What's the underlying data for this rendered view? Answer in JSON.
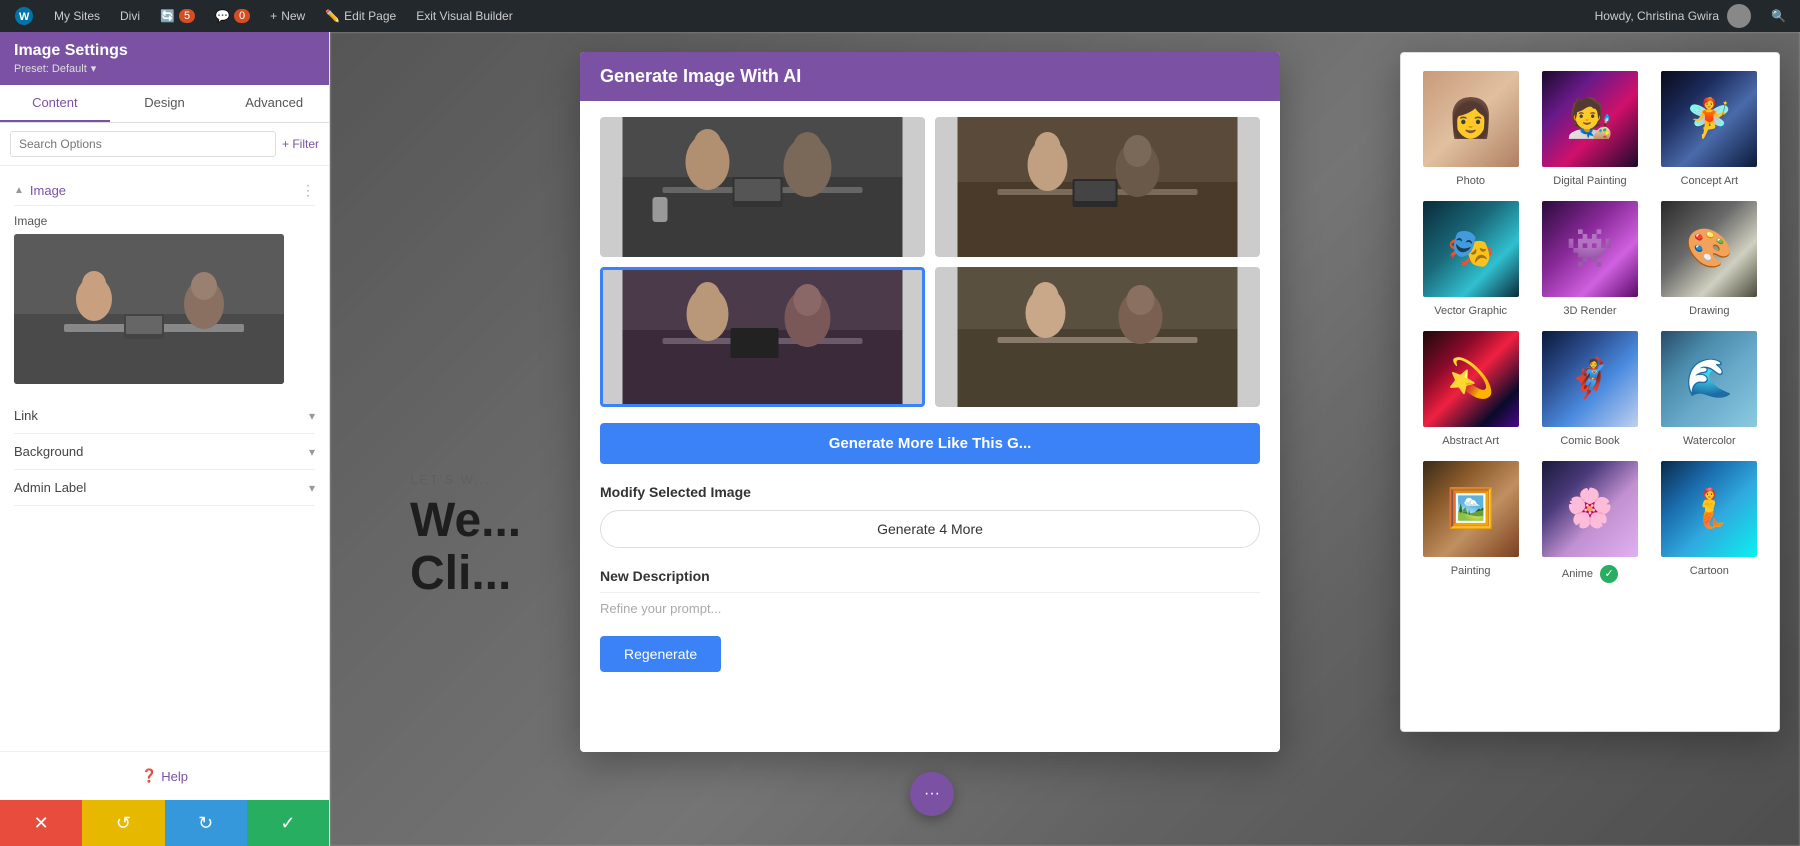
{
  "adminBar": {
    "wpLabel": "WordPress",
    "mySites": "My Sites",
    "divi": "Divi",
    "updates": "5",
    "comments": "0",
    "new": "New",
    "editPage": "Edit Page",
    "exitBuilder": "Exit Visual Builder",
    "user": "Howdy, Christina Gwira"
  },
  "leftPanel": {
    "title": "Image Settings",
    "preset": "Preset: Default",
    "tabs": [
      "Content",
      "Design",
      "Advanced"
    ],
    "activeTab": 0,
    "searchPlaceholder": "Search Options",
    "filterLabel": "+ Filter",
    "sections": {
      "image": {
        "title": "Image",
        "label": "Image"
      },
      "link": {
        "title": "Link"
      },
      "background": {
        "title": "Background"
      },
      "adminLabel": {
        "title": "Admin Label"
      }
    },
    "helpLabel": "Help"
  },
  "bottomBar": {
    "cancelLabel": "✕",
    "undoLabel": "↺",
    "redoLabel": "↻",
    "saveLabel": "✓"
  },
  "aiModal": {
    "title": "Generate Image With AI",
    "generateMoreLabel": "Generate More Like This G...",
    "modifyLabel": "Modify Selected Image",
    "generate4Label": "Generate 4 More",
    "newDescLabel": "New Description",
    "refinePlaceholder": "Refine your prompt...",
    "regenLabel": "Regenerate"
  },
  "stylePanel": {
    "styles": [
      {
        "key": "photo",
        "label": "Photo",
        "cssClass": "st-photo"
      },
      {
        "key": "digital-painting",
        "label": "Digital Painting",
        "cssClass": "st-digital"
      },
      {
        "key": "concept-art",
        "label": "Concept Art",
        "cssClass": "st-concept"
      },
      {
        "key": "vector-graphic",
        "label": "Vector Graphic",
        "cssClass": "st-vector"
      },
      {
        "key": "3d-render",
        "label": "3D Render",
        "cssClass": "st-3drender"
      },
      {
        "key": "drawing",
        "label": "Drawing",
        "cssClass": "st-drawing"
      },
      {
        "key": "abstract-art",
        "label": "Abstract Art",
        "cssClass": "st-abstract"
      },
      {
        "key": "comic-book",
        "label": "Comic Book",
        "cssClass": "st-comic"
      },
      {
        "key": "watercolor",
        "label": "Watercolor",
        "cssClass": "st-watercolor"
      },
      {
        "key": "painting",
        "label": "Painting",
        "cssClass": "st-painting"
      },
      {
        "key": "anime",
        "label": "Anime",
        "cssClass": "st-anime",
        "selected": false,
        "checked": true
      },
      {
        "key": "cartoon",
        "label": "Cartoon",
        "cssClass": "st-cartoon"
      }
    ]
  },
  "pageContent": {
    "letsWork": "LET'S W...",
    "heading": "We...\nCli..."
  },
  "floatingBtn": {
    "label": "···"
  }
}
